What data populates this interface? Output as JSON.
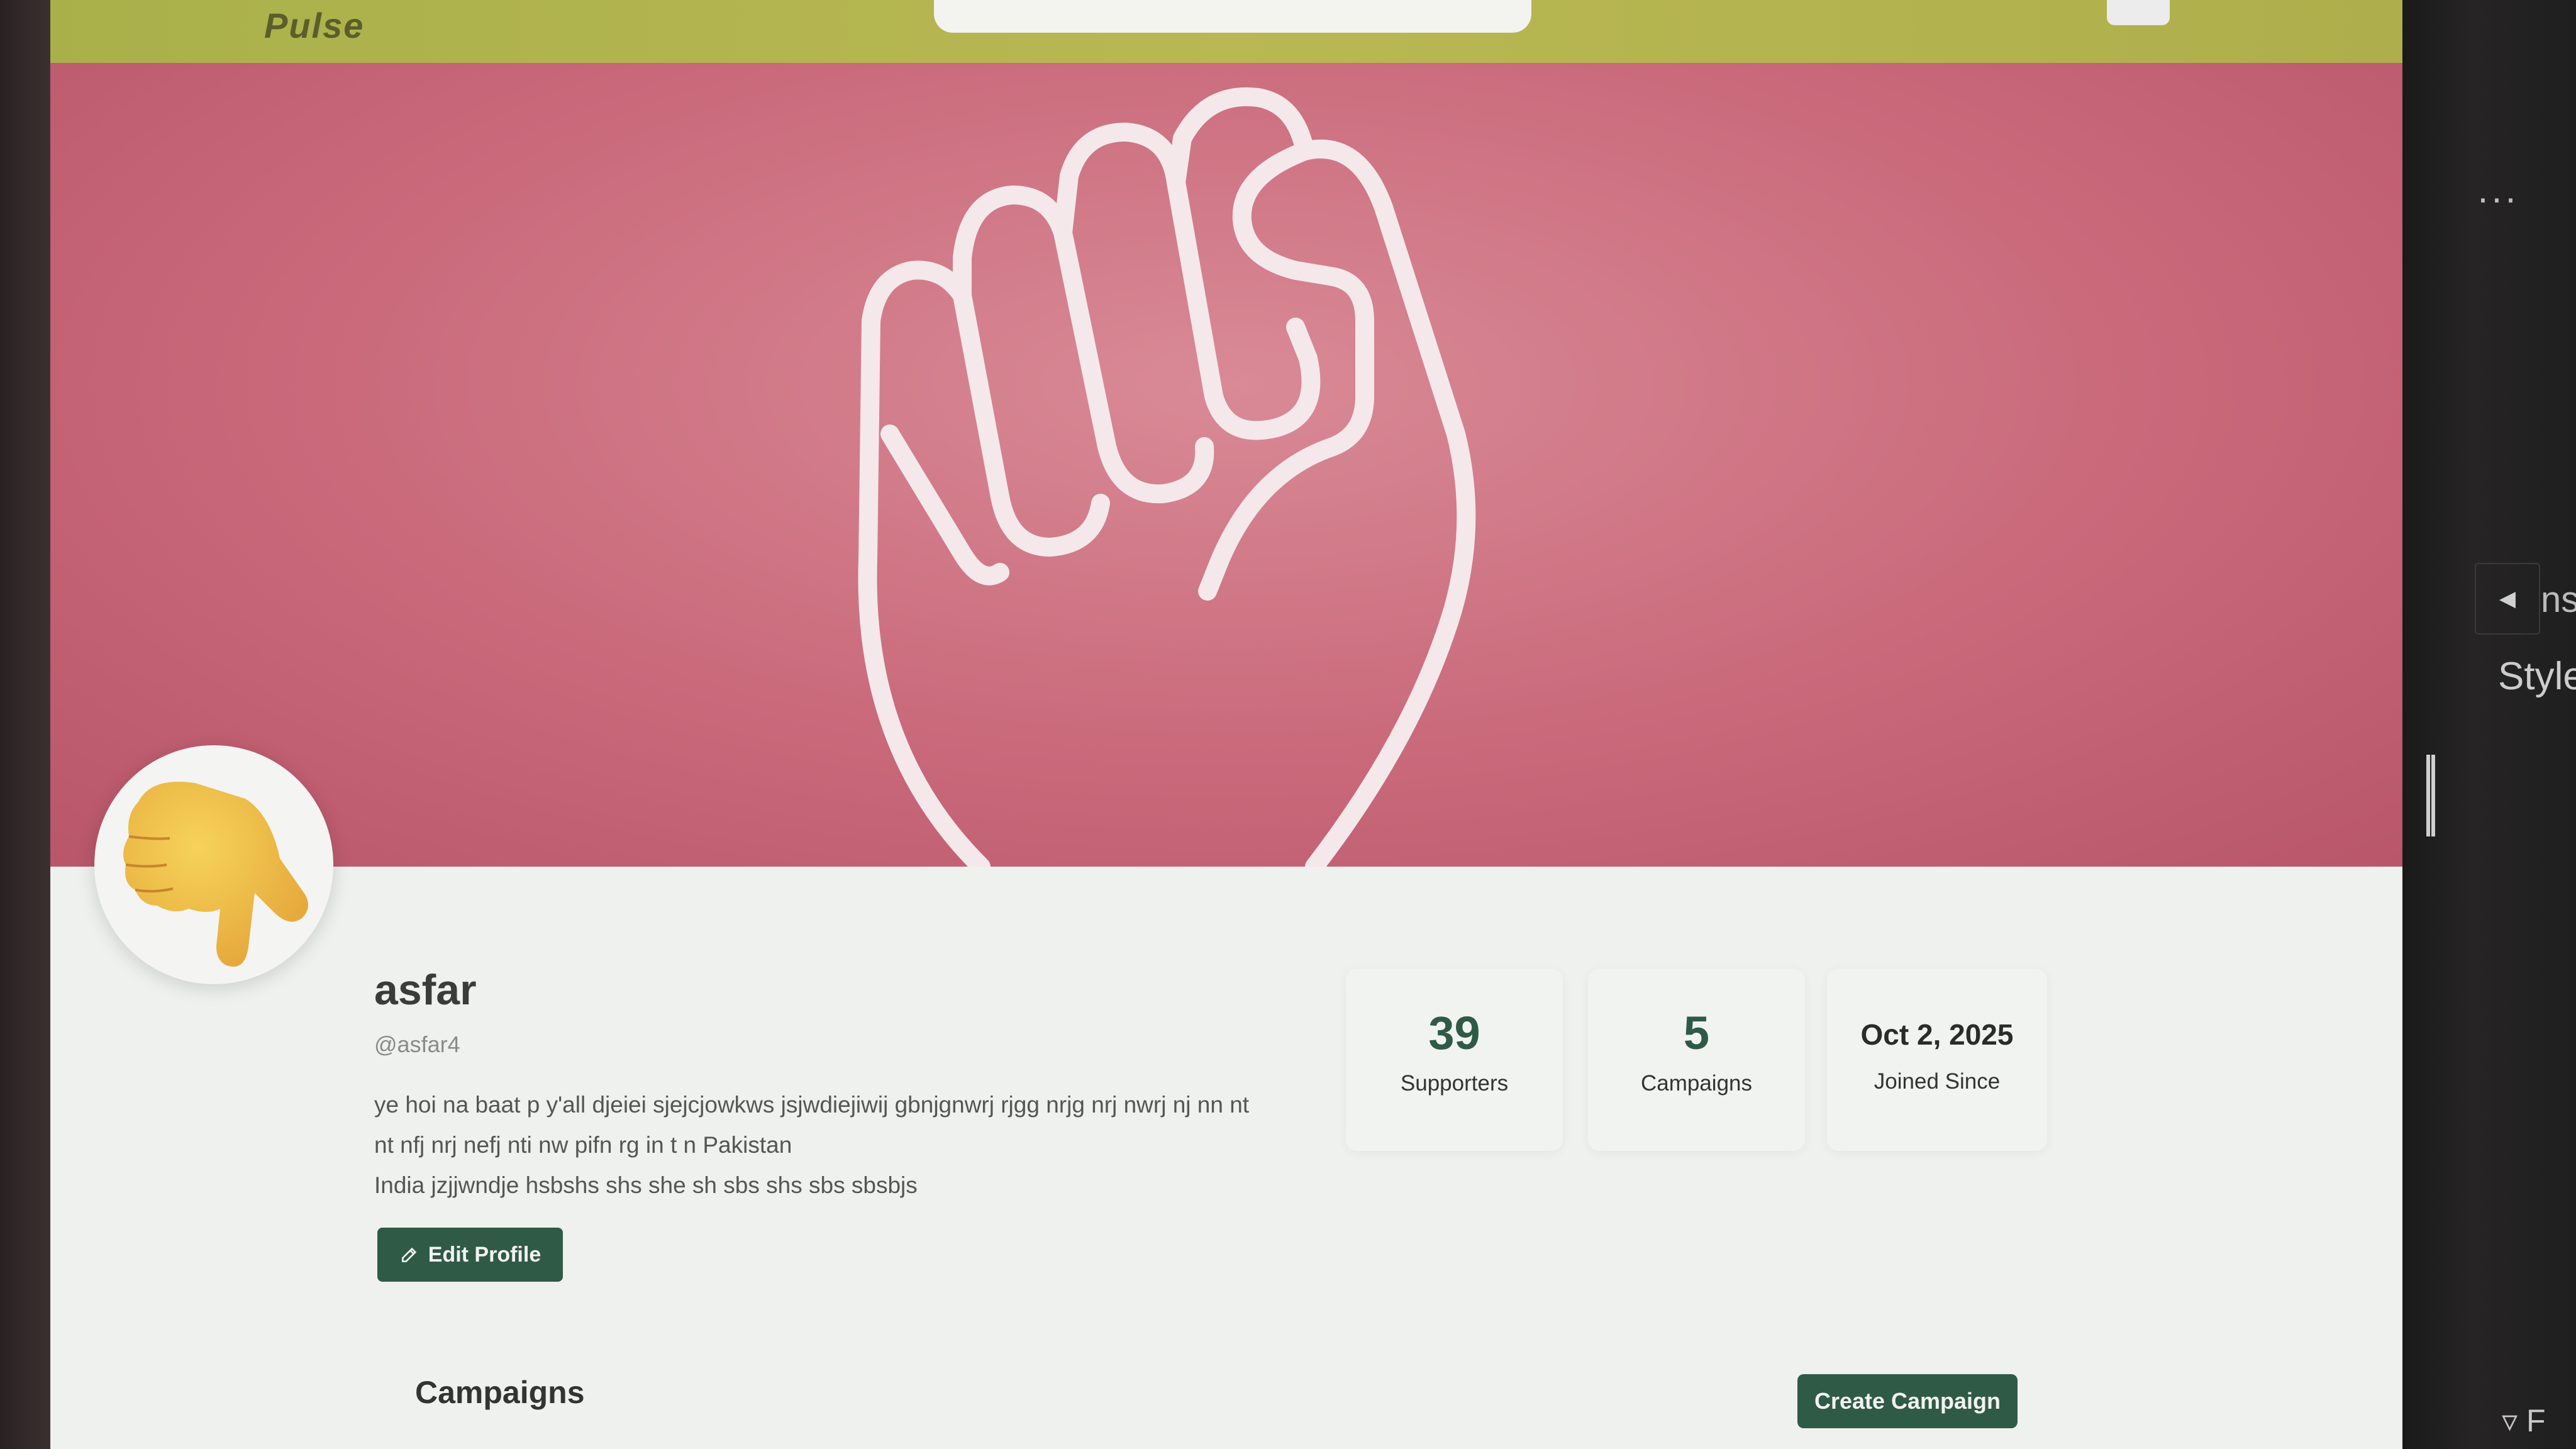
{
  "header": {
    "brand": "Pulse"
  },
  "profile": {
    "name": "asfar",
    "handle": "@asfar4",
    "bio_lines": [
      "ye hoi na baat p y'all djeiei sjejcjowkws jsjwdiejiwij gbnjgnwrj rjgg nrjg nrj nwrj nj nn nt",
      "nt nfj nrj nefj nti nw pifn rg in t n Pakistan",
      "India jzjjwndje hsbshs shs she sh sbs shs sbs sbsbjs"
    ],
    "edit_button": "Edit Profile"
  },
  "stats": [
    {
      "value": "39",
      "label": "Supporters"
    },
    {
      "value": "5",
      "label": "Campaigns"
    },
    {
      "value": "Oct 2, 2025",
      "label": "Joined Since"
    }
  ],
  "campaigns": {
    "title": "Campaigns",
    "create_button": "Create Campaign"
  },
  "side_panel": {
    "tab_fragment": "ns",
    "style_label": "Style",
    "filter_fragment": "F"
  },
  "icons": {
    "banner": "raised-fist-icon",
    "avatar": "pointing-hand-icon",
    "edit": "edit-pencil-icon",
    "arrow": "caret-left-icon",
    "more": "more-dots-icon",
    "filter": "filter-icon"
  },
  "colors": {
    "accent": "#2f5a46",
    "header": "#b9b853",
    "banner": "#c9697a"
  }
}
